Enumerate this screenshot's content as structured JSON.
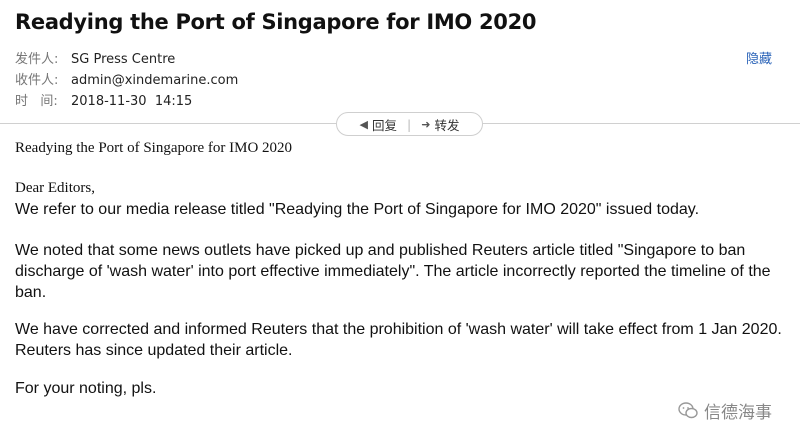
{
  "email": {
    "subject": "Readying the Port of Singapore for IMO 2020",
    "from_label": "发件人:",
    "from_value": "SG Press Centre",
    "to_label": "收件人:",
    "to_value": "admin@xindemarine.com",
    "time_label": "时   间:",
    "time_value": "2018-11-30  14:15",
    "hide_label": "隐藏"
  },
  "actions": {
    "reply_label": "回复",
    "forward_label": "转发"
  },
  "content": {
    "heading": "Readying the Port of Singapore for IMO 2020",
    "greeting": "Dear Editors,",
    "line1": "We refer to our media release titled \"Readying the Port of Singapore for IMO 2020\" issued today.",
    "para2": "We noted that some news outlets have picked up and published Reuters article titled \"Singapore to ban discharge of 'wash water' into port effective immediately\". The article incorrectly reported the timeline of the ban.",
    "para3": "We have corrected and informed Reuters that the prohibition of 'wash water' will take effect from 1 Jan 2020. Reuters has since updated their article.",
    "closing": "For your noting, pls."
  },
  "watermark": {
    "text": "信德海事",
    "icon": "wechat-icon"
  }
}
